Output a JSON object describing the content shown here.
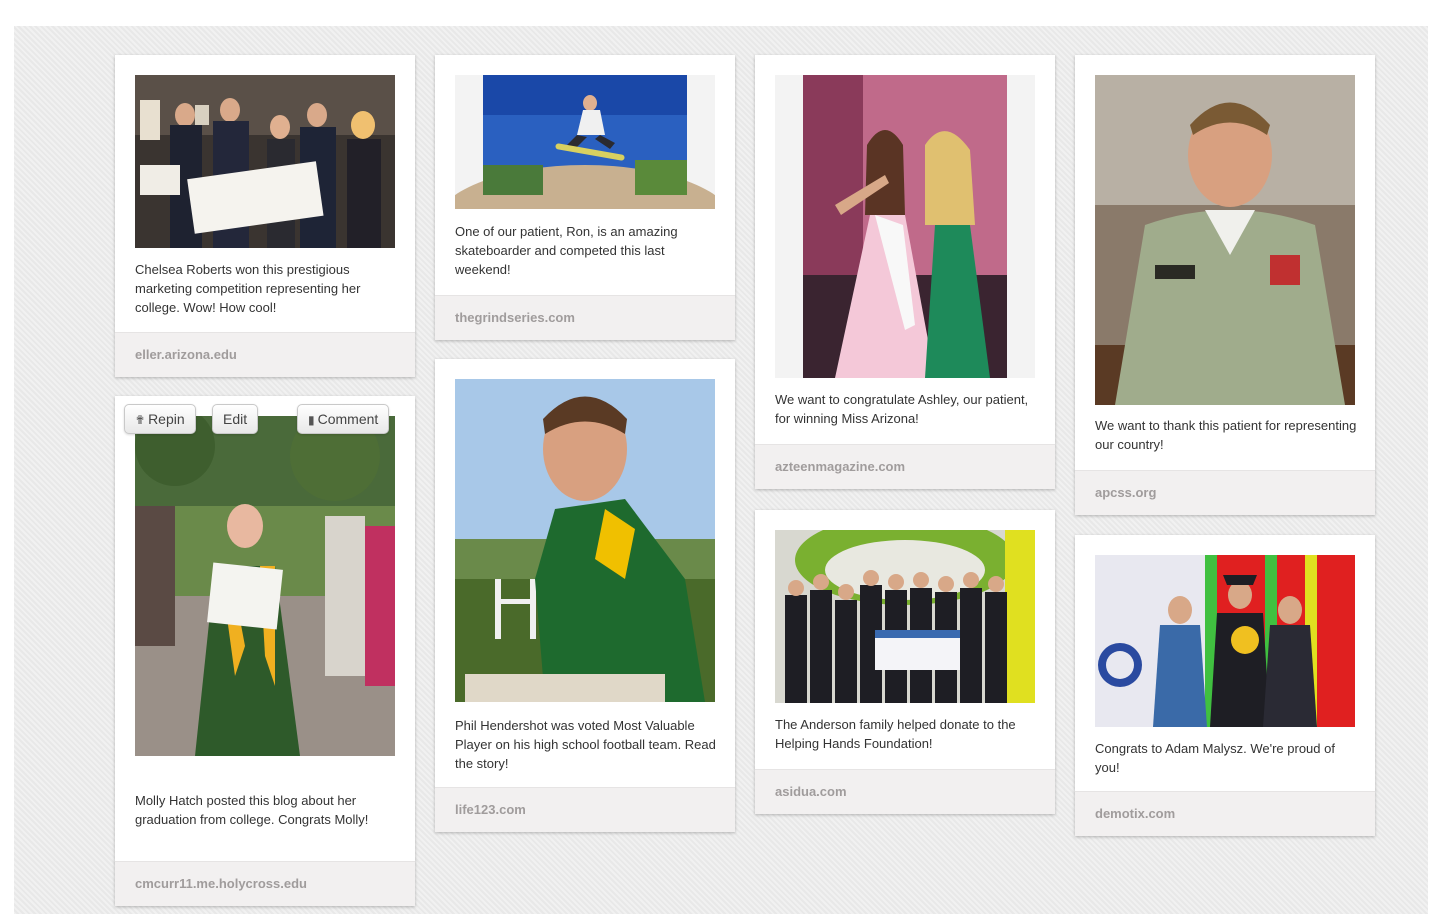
{
  "colors": {
    "board_bg": "#ececec",
    "source_bar": "#f2f0f0",
    "caption_text": "#333333",
    "source_text": "#a09c9c"
  },
  "hover_actions": {
    "repin_label": "Repin",
    "edit_label": "Edit",
    "comment_label": "Comment",
    "repin_icon": "pushpin-icon",
    "comment_icon": "speech-bubble-icon"
  },
  "pins": [
    {
      "caption": "Chelsea Roberts won this prestigious marketing competition representing her college. Wow! How cool!",
      "source": "eller.arizona.edu"
    },
    {
      "caption": "Molly Hatch posted this blog about her graduation from college. Congrats Molly!",
      "source": "cmcurr11.me.holycross.edu"
    },
    {
      "caption": "One of our patient, Ron, is an amazing skateboarder and competed this last weekend!",
      "source": "thegrindseries.com"
    },
    {
      "caption": "Phil Hendershot was voted Most Valuable Player on his high school football team. Read the story!",
      "source": "life123.com"
    },
    {
      "caption": "We want to congratulate Ashley, our patient, for winning Miss Arizona!",
      "source": "azteenmagazine.com"
    },
    {
      "caption": "The Anderson family helped donate to the Helping Hands Foundation!",
      "source": "asidua.com"
    },
    {
      "caption": "We want to thank this patient for representing our country!",
      "source": "apcss.org"
    },
    {
      "caption": "Congrats to Adam Malysz. We're proud of you!",
      "source": "demotix.com"
    }
  ]
}
